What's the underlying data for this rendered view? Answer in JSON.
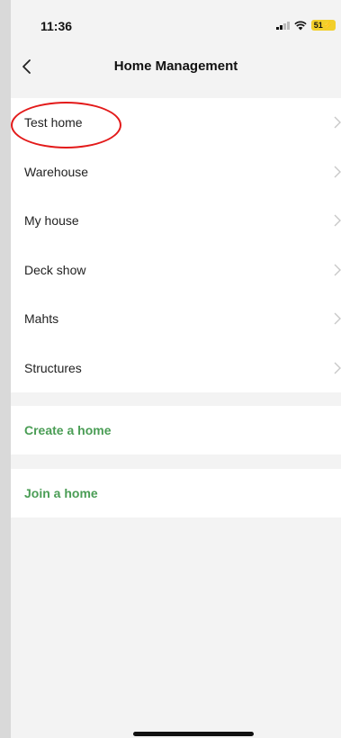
{
  "status_bar": {
    "time": "11:36",
    "battery": "51",
    "icons": [
      "signal-icon",
      "wifi-icon",
      "battery-icon"
    ]
  },
  "nav": {
    "title": "Home Management",
    "back_icon": "chevron-left-icon"
  },
  "homes": [
    {
      "label": "Test home",
      "highlighted": true
    },
    {
      "label": "Warehouse"
    },
    {
      "label": "My house"
    },
    {
      "label": "Deck show"
    },
    {
      "label": "Mahts"
    },
    {
      "label": "Structures"
    }
  ],
  "actions": {
    "create_label": "Create a home",
    "join_label": "Join a home"
  },
  "colors": {
    "accent": "#4a9d55",
    "background": "#f3f3f3",
    "highlight": "#e31a1a",
    "battery": "#f2cf2b"
  }
}
